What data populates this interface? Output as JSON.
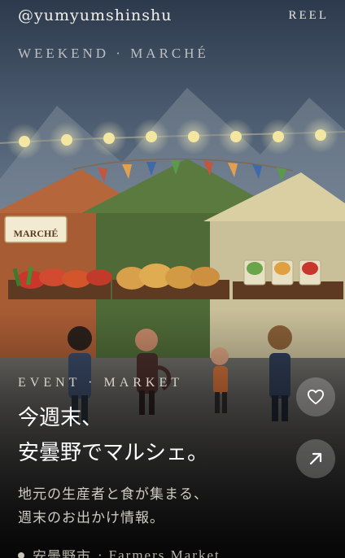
{
  "top_bar": {
    "handle": "@yumyumshinshu",
    "reel_label": "REEL"
  },
  "subheading": "WEEKEND · MARCHÉ",
  "scene": {
    "stall_sign": "MARCHÉ"
  },
  "caption": {
    "eyebrow": "EVENT · MARKET",
    "title_line1": "今週末、",
    "title_line2": "安曇野でマルシェ。",
    "desc_line1": "地元の生産者と食が集まる、",
    "desc_line2": "週末のお出かけ情報。"
  },
  "meta": {
    "place": "安曇野市",
    "separator": "·",
    "tag": "Farmers Market"
  },
  "actions": {
    "like_icon": "heart-icon",
    "share_icon": "arrow-up-right-icon"
  },
  "colors": {
    "sky_top": "#2f3d52",
    "tent_orange": "#b5663a",
    "tent_green": "#5b7a3f",
    "tent_cream": "#d9cfa2",
    "lights": "#f2e6a0"
  }
}
